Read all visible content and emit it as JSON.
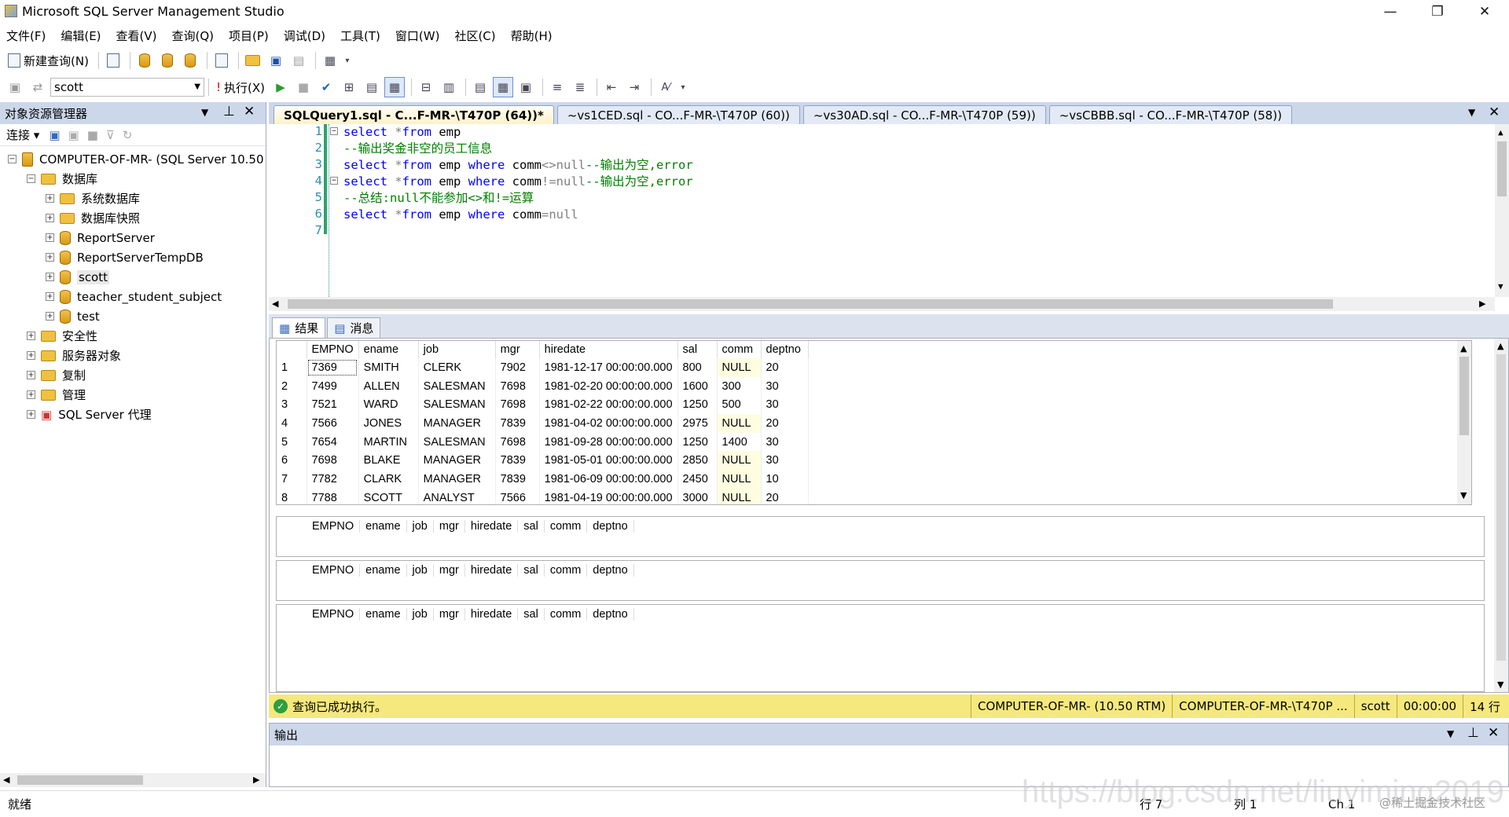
{
  "app": {
    "title": "Microsoft SQL Server Management Studio"
  },
  "menu": [
    "文件(F)",
    "编辑(E)",
    "查看(V)",
    "查询(Q)",
    "项目(P)",
    "调试(D)",
    "工具(T)",
    "窗口(W)",
    "社区(C)",
    "帮助(H)"
  ],
  "toolbar": {
    "new_query": "新建查询(N)",
    "database": "scott",
    "execute": "执行(X)"
  },
  "object_explorer": {
    "title": "对象资源管理器",
    "connect": "连接",
    "server": "COMPUTER-OF-MR- (SQL Server 10.50",
    "databases_folder": "数据库",
    "items": [
      "系统数据库",
      "数据库快照",
      "ReportServer",
      "ReportServerTempDB",
      "scott",
      "teacher_student_subject",
      "test"
    ],
    "folders": [
      "安全性",
      "服务器对象",
      "复制",
      "管理"
    ],
    "agent": "SQL Server 代理"
  },
  "tabs": [
    "SQLQuery1.sql - C...F-MR-\\T470P (64))*",
    "~vs1CED.sql - CO...F-MR-\\T470P (60))",
    "~vs30AD.sql - CO...F-MR-\\T470P (59))",
    "~vsCBBB.sql - CO...F-MR-\\T470P (58))"
  ],
  "editor": {
    "line_numbers": [
      "1",
      "2",
      "3",
      "4",
      "5",
      "6",
      "7"
    ],
    "lines": [
      {
        "a": "select ",
        "b": "*",
        "c": "from ",
        "d": "emp",
        "e": "",
        "f": ""
      },
      {
        "comment": "--输出奖金非空的员工信息"
      },
      {
        "a": "select ",
        "b": "*",
        "c": "from ",
        "d": "emp ",
        "w": "where ",
        "col": "comm",
        "op": "<>",
        "nul": "null",
        "cmt": "--输出为空,error"
      },
      {
        "a": "select ",
        "b": "*",
        "c": "from ",
        "d": "emp ",
        "w": "where ",
        "col": "comm",
        "op": "!=",
        "nul": "null",
        "cmt": "--输出为空,error"
      },
      {
        "comment": "--总结:null不能参加<>和!=运算"
      },
      {
        "a": "select ",
        "b": "*",
        "c": "from ",
        "d": "emp ",
        "w": "where ",
        "col": "comm",
        "op": "=",
        "nul": "null"
      },
      {
        "comment": ""
      }
    ]
  },
  "results": {
    "tab_results": "结果",
    "tab_messages": "消息",
    "columns": [
      "EMPNO",
      "ename",
      "job",
      "mgr",
      "hiredate",
      "sal",
      "comm",
      "deptno"
    ],
    "rows": [
      [
        "1",
        "7369",
        "SMITH",
        "CLERK",
        "7902",
        "1981-12-17 00:00:00.000",
        "800",
        "NULL",
        "20"
      ],
      [
        "2",
        "7499",
        "ALLEN",
        "SALESMAN",
        "7698",
        "1981-02-20 00:00:00.000",
        "1600",
        "300",
        "30"
      ],
      [
        "3",
        "7521",
        "WARD",
        "SALESMAN",
        "7698",
        "1981-02-22 00:00:00.000",
        "1250",
        "500",
        "30"
      ],
      [
        "4",
        "7566",
        "JONES",
        "MANAGER",
        "7839",
        "1981-04-02 00:00:00.000",
        "2975",
        "NULL",
        "20"
      ],
      [
        "5",
        "7654",
        "MARTIN",
        "SALESMAN",
        "7698",
        "1981-09-28 00:00:00.000",
        "1250",
        "1400",
        "30"
      ],
      [
        "6",
        "7698",
        "BLAKE",
        "MANAGER",
        "7839",
        "1981-05-01 00:00:00.000",
        "2850",
        "NULL",
        "30"
      ],
      [
        "7",
        "7782",
        "CLARK",
        "MANAGER",
        "7839",
        "1981-06-09 00:00:00.000",
        "2450",
        "NULL",
        "10"
      ],
      [
        "8",
        "7788",
        "SCOTT",
        "ANALYST",
        "7566",
        "1981-04-19 00:00:00.000",
        "3000",
        "NULL",
        "20"
      ]
    ]
  },
  "status_query": {
    "message": "查询已成功执行。",
    "server": "COMPUTER-OF-MR- (10.50 RTM)",
    "connection": "COMPUTER-OF-MR-\\T470P ...",
    "user": "scott",
    "time": "00:00:00",
    "rows": "14 行"
  },
  "output": {
    "title": "输出"
  },
  "statusbar": {
    "ready": "就绪",
    "line": "行 7",
    "col": "列 1",
    "ch": "Ch 1"
  },
  "watermark": "https://blog.csdn.net/liuyiming2019",
  "watermark2": "@稀土掘金技术社区",
  "colors": {
    "panel_header": "#ccd7ea",
    "status_yellow": "#f5e87c",
    "keyword": "#0000ff",
    "comment": "#008000"
  }
}
